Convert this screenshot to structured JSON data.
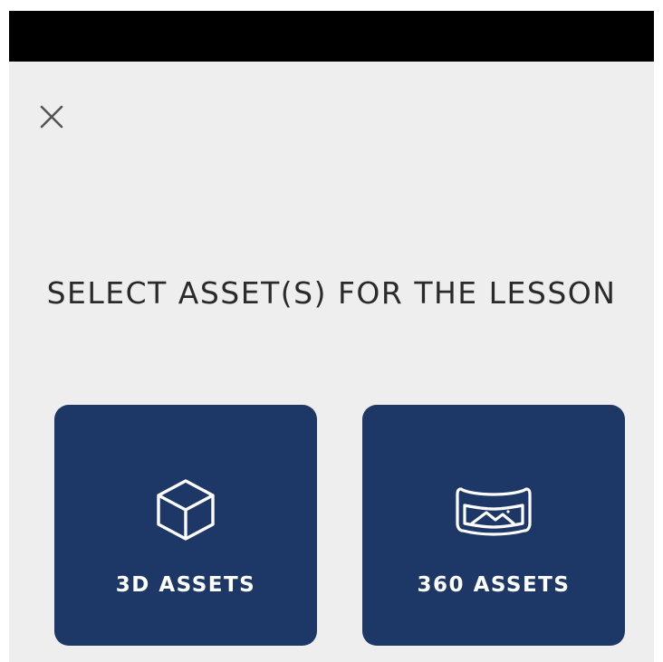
{
  "dialog": {
    "title": "SELECT ASSET(S) FOR THE LESSON",
    "close_icon": "close-icon"
  },
  "options": [
    {
      "label": "3D ASSETS",
      "icon": "cube-icon"
    },
    {
      "label": "360 ASSETS",
      "icon": "panorama-icon"
    }
  ],
  "colors": {
    "background": "#eeeeee",
    "top_bar": "#000000",
    "card": "#1d3766",
    "card_text": "#ffffff",
    "title_text": "#2a2a2a",
    "close_icon": "#555555"
  }
}
